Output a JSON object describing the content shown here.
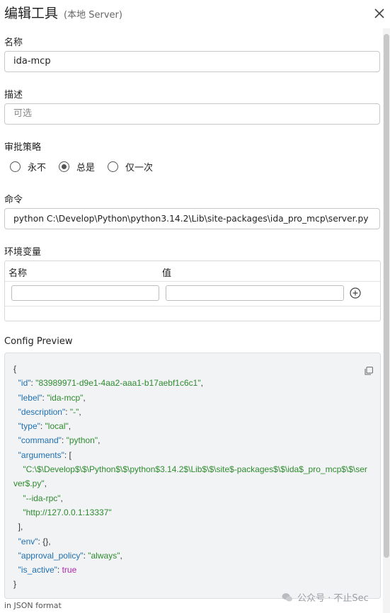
{
  "header": {
    "title": "编辑工具",
    "subtitle": "(本地 Server)"
  },
  "fields": {
    "name_label": "名称",
    "name_value": "ida-mcp",
    "desc_label": "描述",
    "desc_placeholder": "可选",
    "policy_label": "审批策略",
    "policy_options": [
      "永不",
      "总是",
      "仅一次"
    ],
    "policy_selected": "总是",
    "command_label": "命令",
    "command_value": "python C:\\Develop\\Python\\python3.14.2\\Lib\\site-packages\\ida_pro_mcp\\server.py",
    "env_label": "环境变量",
    "env_col_name": "名称",
    "env_col_value": "值"
  },
  "preview": {
    "label": "Config Preview",
    "lines": {
      "open": "{",
      "id_k": "\"id\"",
      "id_v": "\"83989971-d9e1-4aa2-aaa1-b17aebf1c6c1\"",
      "lebel_k": "\"lebel\"",
      "lebel_v": "\"ida-mcp\"",
      "desc_k": "\"description\"",
      "desc_v": "\"-\"",
      "type_k": "\"type\"",
      "type_v": "\"local\"",
      "cmd_k": "\"command\"",
      "cmd_v": "\"python\"",
      "args_k": "\"arguments\"",
      "arg1a": "\"C:\\$\\Develop$\\$\\Python$\\$\\python$3.14.2$\\Lib$\\$\\site$-packages$\\$\\ida$_pro_mcp$\\$\\ser",
      "arg1b": "ver$.py\"",
      "arg2": "\"--ida-rpc\"",
      "arg3": "\"http://127.0.0.1:13337\"",
      "env_k": "\"env\"",
      "env_v": "{}",
      "ap_k": "\"approval_policy\"",
      "ap_v": "\"always\"",
      "act_k": "\"is_active\"",
      "act_v": "true",
      "close": "}"
    }
  },
  "footer": "in JSON format",
  "watermark": "公众号 · 不止Sec"
}
